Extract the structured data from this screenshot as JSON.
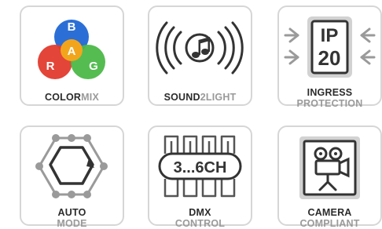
{
  "features": [
    {
      "id": "colormix",
      "label_primary": "COLOR",
      "label_secondary": "MIX",
      "icon": "rgba-color-circles-icon",
      "letters": {
        "b": "B",
        "a": "A",
        "r": "R",
        "g": "G"
      },
      "colors": {
        "blue": "#2b6fd6",
        "amber": "#f2a51c",
        "red": "#e23b2e",
        "green": "#4cb848"
      }
    },
    {
      "id": "sound2light",
      "label_primary": "SOUND",
      "label_number": "2",
      "label_secondary": "LIGHT",
      "icon": "music-note-sound-waves-icon"
    },
    {
      "id": "ingress",
      "label_primary": "INGRESS",
      "label_secondary": "PROTECTION",
      "icon": "ip20-rating-icon",
      "ip_text": "IP",
      "ip_number": "20"
    },
    {
      "id": "auto",
      "label_primary": "AUTO",
      "label_secondary": "MODE",
      "icon": "auto-mode-hexagon-icon"
    },
    {
      "id": "dmx",
      "label_primary": "DMX",
      "label_secondary": "CONTROL",
      "icon": "dmx-channels-icon",
      "channels_text": "3...6CH"
    },
    {
      "id": "camera",
      "label_primary": "CAMERA",
      "label_secondary": "COMPLIANT",
      "icon": "film-camera-icon"
    }
  ],
  "palette": {
    "icon_dark": "#333333",
    "icon_gray": "#8a8a8a",
    "border": "#d6d6d6"
  }
}
